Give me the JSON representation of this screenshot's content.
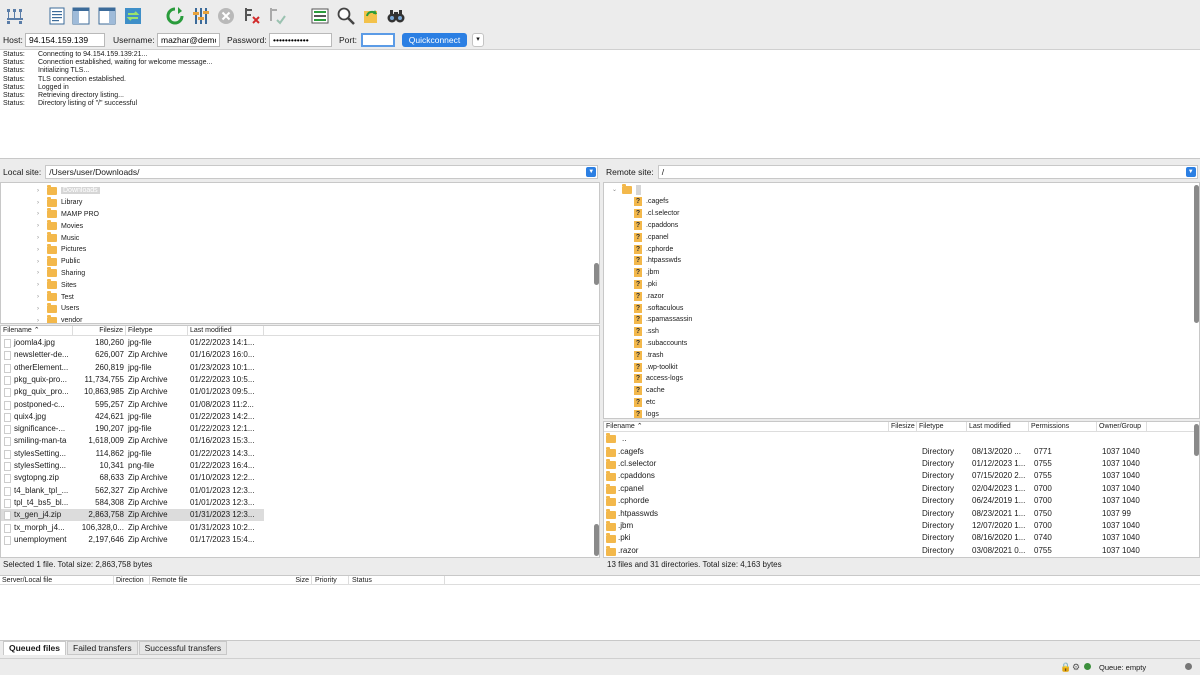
{
  "toolbar": {
    "icons": [
      "site-manager-icon",
      "toggle-log-icon",
      "toggle-local-tree-icon",
      "toggle-remote-tree-icon",
      "toggle-queue-icon",
      "refresh-icon",
      "process-queue-icon",
      "cancel-icon",
      "disconnect-icon",
      "reconnect-icon",
      "directory-compare-icon",
      "filter-icon",
      "sync-browse-icon",
      "search-icon"
    ]
  },
  "quickconnect": {
    "host_label": "Host:",
    "host_value": "94.154.159.139",
    "username_label": "Username:",
    "username_value": "mazhar@demo.",
    "password_label": "Password:",
    "password_value": "••••••••••••",
    "port_label": "Port:",
    "port_value": "",
    "button_label": "Quickconnect",
    "dropdown_glyph": "▾"
  },
  "log": [
    {
      "label": "Status:",
      "text": "Connecting to 94.154.159.139:21..."
    },
    {
      "label": "Status:",
      "text": "Connection established, waiting for welcome message..."
    },
    {
      "label": "Status:",
      "text": "Initializing TLS..."
    },
    {
      "label": "Status:",
      "text": "TLS connection established."
    },
    {
      "label": "Status:",
      "text": "Logged in"
    },
    {
      "label": "Status:",
      "text": "Retrieving directory listing..."
    },
    {
      "label": "Status:",
      "text": "Directory listing of \"/\" successful"
    }
  ],
  "local": {
    "site_label": "Local site:",
    "site_path": "/Users/user/Downloads/",
    "tree": [
      "Downloads",
      "Library",
      "MAMP PRO",
      "Movies",
      "Music",
      "Pictures",
      "Public",
      "Sharing",
      "Sites",
      "Test",
      "Users",
      "vendor"
    ],
    "headers": {
      "name": "Filename ⌃",
      "size": "Filesize",
      "type": "Filetype",
      "modified": "Last modified"
    },
    "files": [
      {
        "name": "joomla4.jpg",
        "size": "180,260",
        "type": "jpg-file",
        "modified": "01/22/2023 14:1..."
      },
      {
        "name": "newsletter-de...",
        "size": "626,007",
        "type": "Zip Archive",
        "modified": "01/16/2023 16:0..."
      },
      {
        "name": "otherElement...",
        "size": "260,819",
        "type": "jpg-file",
        "modified": "01/23/2023 10:1..."
      },
      {
        "name": "pkg_quix-pro...",
        "size": "11,734,755",
        "type": "Zip Archive",
        "modified": "01/22/2023 10:5..."
      },
      {
        "name": "pkg_quix_pro...",
        "size": "10,863,985",
        "type": "Zip Archive",
        "modified": "01/01/2023 09:5..."
      },
      {
        "name": "postponed-c...",
        "size": "595,257",
        "type": "Zip Archive",
        "modified": "01/08/2023 11:2..."
      },
      {
        "name": "quix4.jpg",
        "size": "424,621",
        "type": "jpg-file",
        "modified": "01/22/2023 14:2..."
      },
      {
        "name": "significance-...",
        "size": "190,207",
        "type": "jpg-file",
        "modified": "01/22/2023 12:1..."
      },
      {
        "name": "smiling-man-ta",
        "size": "1,618,009",
        "type": "Zip Archive",
        "modified": "01/16/2023 15:3..."
      },
      {
        "name": "stylesSetting...",
        "size": "114,862",
        "type": "jpg-file",
        "modified": "01/22/2023 14:3..."
      },
      {
        "name": "stylesSetting...",
        "size": "10,341",
        "type": "png-file",
        "modified": "01/22/2023 16:4..."
      },
      {
        "name": "svgtopng.zip",
        "size": "68,633",
        "type": "Zip Archive",
        "modified": "01/10/2023 12:2..."
      },
      {
        "name": "t4_blank_tpl_...",
        "size": "562,327",
        "type": "Zip Archive",
        "modified": "01/01/2023 12:3..."
      },
      {
        "name": "tpl_t4_bs5_bl...",
        "size": "584,308",
        "type": "Zip Archive",
        "modified": "01/01/2023 12:3..."
      },
      {
        "name": "tx_gen_j4.zip",
        "size": "2,863,758",
        "type": "Zip Archive",
        "modified": "01/31/2023 12:3..."
      },
      {
        "name": "tx_morph_j4...",
        "size": "106,328,0...",
        "type": "Zip Archive",
        "modified": "01/31/2023 10:2..."
      },
      {
        "name": "unemployment",
        "size": "2,197,646",
        "type": "Zip Archive",
        "modified": "01/17/2023 15:4..."
      }
    ],
    "selected_index": 14,
    "status": "Selected 1 file. Total size: 2,863,758 bytes"
  },
  "remote": {
    "site_label": "Remote site:",
    "site_path": "/",
    "tree": [
      ".cagefs",
      ".cl.selector",
      ".cpaddons",
      ".cpanel",
      ".cphorde",
      ".htpasswds",
      ".jbm",
      ".pki",
      ".razor",
      ".softaculous",
      ".spamassassin",
      ".ssh",
      ".subaccounts",
      ".trash",
      ".wp-toolkit",
      "access-logs",
      "cache",
      "etc",
      "logs"
    ],
    "headers": {
      "name": "Filename ⌃",
      "size": "Filesize",
      "type": "Filetype",
      "modified": "Last modified",
      "perms": "Permissions",
      "owner": "Owner/Group"
    },
    "parent": "..",
    "files": [
      {
        "name": ".cagefs",
        "type": "Directory",
        "modified": "08/13/2020 ...",
        "perms": "0771",
        "owner": "1037 1040"
      },
      {
        "name": ".cl.selector",
        "type": "Directory",
        "modified": "01/12/2023 1...",
        "perms": "0755",
        "owner": "1037 1040"
      },
      {
        "name": ".cpaddons",
        "type": "Directory",
        "modified": "07/15/2020 2...",
        "perms": "0755",
        "owner": "1037 1040"
      },
      {
        "name": ".cpanel",
        "type": "Directory",
        "modified": "02/04/2023 1...",
        "perms": "0700",
        "owner": "1037 1040"
      },
      {
        "name": ".cphorde",
        "type": "Directory",
        "modified": "06/24/2019 1...",
        "perms": "0700",
        "owner": "1037 1040"
      },
      {
        "name": ".htpasswds",
        "type": "Directory",
        "modified": "08/23/2021 1...",
        "perms": "0750",
        "owner": "1037 99"
      },
      {
        "name": ".jbm",
        "type": "Directory",
        "modified": "12/07/2020 1...",
        "perms": "0700",
        "owner": "1037 1040"
      },
      {
        "name": ".pki",
        "type": "Directory",
        "modified": "08/16/2020 1...",
        "perms": "0740",
        "owner": "1037 1040"
      },
      {
        "name": ".razor",
        "type": "Directory",
        "modified": "03/08/2021 0...",
        "perms": "0755",
        "owner": "1037 1040"
      }
    ],
    "status": "13 files and 31 directories. Total size: 4,163 bytes"
  },
  "queue": {
    "headers": {
      "server": "Server/Local file",
      "direction": "Direction",
      "remote": "Remote file",
      "size": "Size",
      "priority": "Priority",
      "status": "Status"
    },
    "tabs": [
      "Queued files",
      "Failed transfers",
      "Successful transfers"
    ],
    "status": "Queue: empty"
  },
  "colors": {
    "accent": "#2b7fe3",
    "folder": "#f3b84b",
    "selection": "#dcdcdc"
  }
}
